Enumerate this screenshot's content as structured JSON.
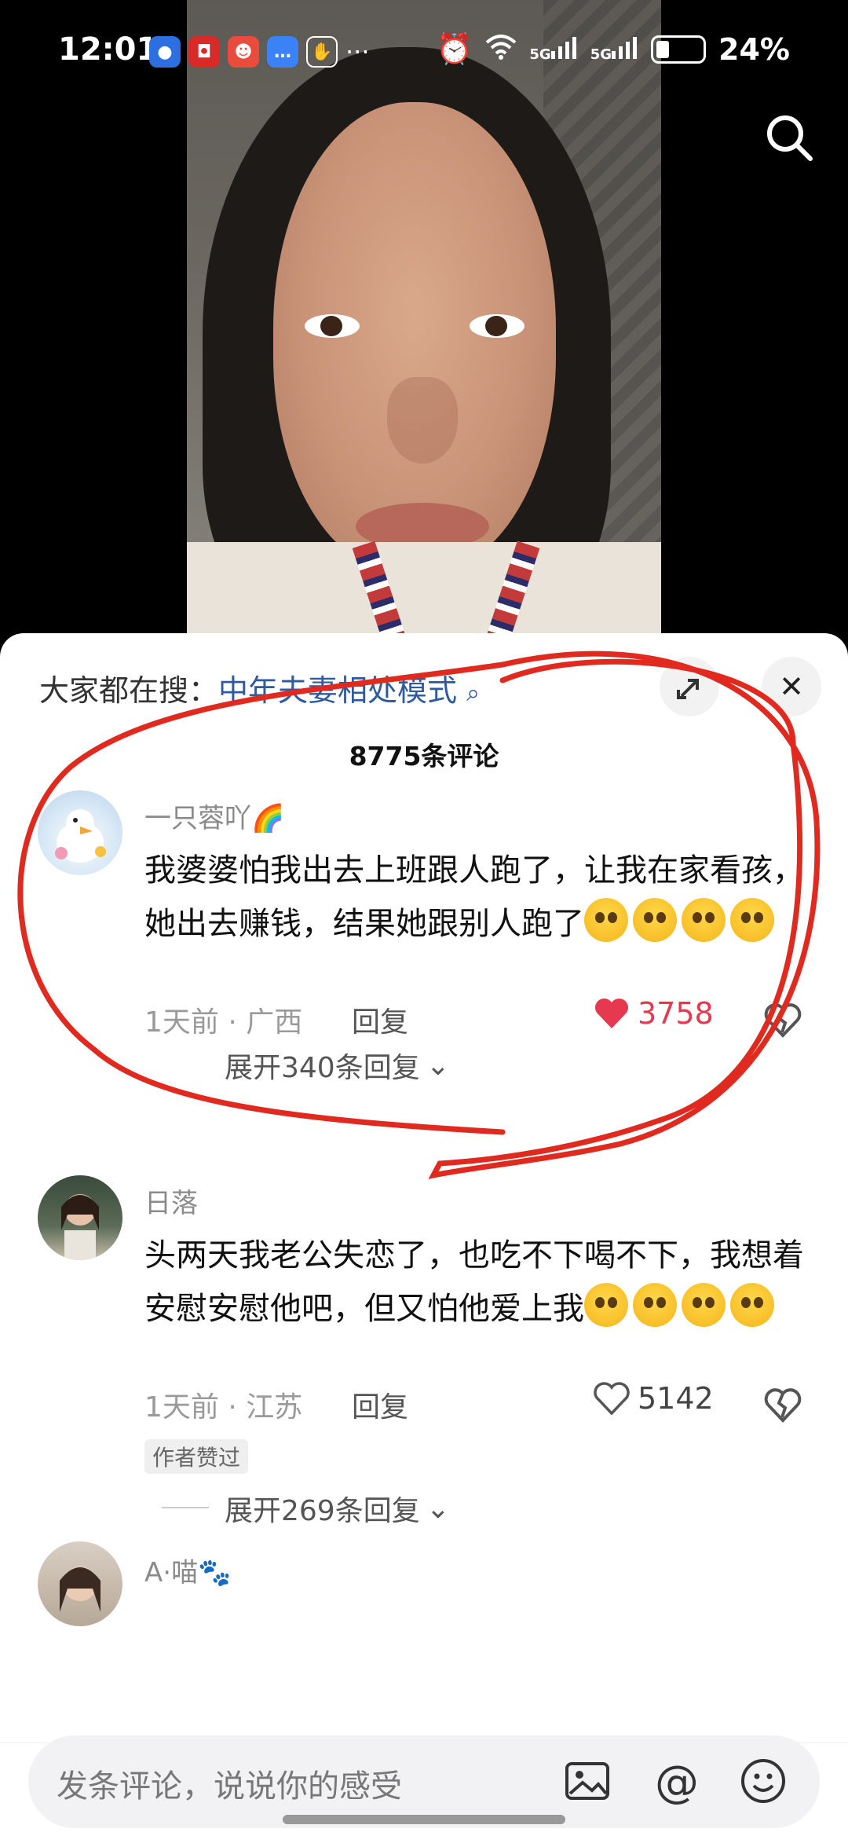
{
  "status": {
    "time": "12:01",
    "battery": "24%",
    "net1": "5G",
    "net2": "5G",
    "more": "···"
  },
  "sheet": {
    "search_prefix": "大家都在搜：",
    "search_keyword": "中年夫妻相处模式",
    "comment_count": "8775条评论"
  },
  "comments": [
    {
      "user": "一只蓉吖🌈",
      "text": "我婆婆怕我出去上班跟人跑了，让我在家看孩，她出去赚钱，结果她跟别人跑了",
      "emoji_count": 4,
      "time_location": "1天前 · 广西",
      "reply_label": "回复",
      "likes": "3758",
      "liked": true,
      "expand": "展开340条回复"
    },
    {
      "user": "日落",
      "text": "头两天我老公失恋了，也吃不下喝不下，我想着安慰安慰他吧，但又怕他爱上我",
      "emoji_count": 4,
      "time_location": "1天前 · 江苏",
      "reply_label": "回复",
      "likes": "5142",
      "liked": false,
      "author_tag": "作者赞过",
      "expand": "展开269条回复"
    },
    {
      "user": "A⁠·喵🐾"
    }
  ],
  "input": {
    "placeholder": "发条评论，说说你的感受"
  },
  "colors": {
    "liked": "#e6394f",
    "keyword": "#2f5a9e",
    "annotation": "#e02a1f"
  }
}
